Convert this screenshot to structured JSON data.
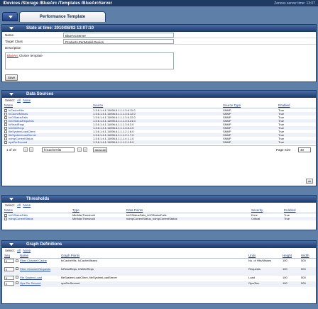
{
  "window": {
    "path_title": "/Devices /Storage /BlueArc /Templates /BlueArcServer",
    "server_time": "Zenoss server time: 13:07"
  },
  "tab": {
    "label": "Performance Template"
  },
  "state_panel": {
    "title": "State at time: 2010/08/02 13:07:10",
    "fields": [
      {
        "label": "Name",
        "value": "BlueArcServer"
      },
      {
        "label": "Target Class",
        "value": "Products.ZenModel.Device"
      },
      {
        "label": "Description",
        "value": ""
      }
    ],
    "description_prefix": "BlueArc",
    "description_rest": " Cluster template",
    "save_label": "Save"
  },
  "select_row": {
    "label": "Select:",
    "all": "All",
    "none": "None"
  },
  "data_sources": {
    "title": "Data Sources",
    "columns": [
      "Name",
      "Source",
      "Source Type",
      "Enabled"
    ],
    "rows": [
      [
        "fcCacheHits",
        "1.3.6.1.4.1.11096.6.1.1.1.3.6.11.0",
        "SNMP",
        "True"
      ],
      [
        "fcCacheMisses",
        "1.3.6.1.4.1.11096.6.1.1.1.3.6.12.0",
        "SNMP",
        "True"
      ],
      [
        "fcIOStatusFails",
        "1.3.6.1.4.1.11096.6.1.1.1.3.6.22.0",
        "SNMP",
        "True"
      ],
      [
        "fcIOStatusRequests",
        "1.3.6.1.4.1.11096.6.1.1.1.3.6.21.0",
        "SNMP",
        "True"
      ],
      [
        "fcReadReqs",
        "1.3.6.1.4.1.11096.6.1.1.1.3.6.3.0",
        "SNMP",
        "True"
      ],
      [
        "fcWriteReqs",
        "1.3.6.1.4.1.11096.6.1.1.1.3.6.4.0",
        "SNMP",
        "True"
      ],
      [
        "fileSystemLoadClient",
        "1.3.6.1.4.1.11096.6.1.1.1.2.1.6.0",
        "SNMP",
        "True"
      ],
      [
        "fileSystemLoadServer",
        "1.3.6.1.4.1.11096.6.1.1.1.2.1.7.0",
        "SNMP",
        "True"
      ],
      [
        "ndmpCurrentStatus",
        "1.3.6.1.4.1.11096.6.1.1.1.4.1.1.0",
        "SNMP",
        "True"
      ],
      [
        "opsPerSecond",
        "1.3.6.1.4.1.11096.6.1.1.1.2.1.5.0",
        "SNMP",
        "True"
      ]
    ],
    "pager": {
      "range": "1 of 10",
      "tool_value": "fcCacheHits",
      "show_all": "show all",
      "page_size_label": "Page Size",
      "page_size_value": "40",
      "ok_label": "ok"
    }
  },
  "thresholds": {
    "title": "Thresholds",
    "columns": [
      "Name",
      "Type",
      "Data Points",
      "Severity",
      "Enabled"
    ],
    "rows": [
      [
        "fcIOStatusFails",
        "MinMaxThreshold",
        "fcIOStatusFails_fcIOStatusFails",
        "Error",
        "True"
      ],
      [
        "ndmpCurrentStatus",
        "MinMaxThreshold",
        "ndmpCurrentStatus_ndmpCurrentStatus",
        "Critical",
        "True"
      ]
    ]
  },
  "graph_definitions": {
    "title": "Graph Definitions",
    "columns": [
      "Seq",
      "Name",
      "Graph Points",
      "Units",
      "Height",
      "Width"
    ],
    "rows": [
      {
        "seq": "0",
        "name": "Fiber Channel Cache",
        "points": "fcCacheHits, fcCacheMisses",
        "units": "No. of Hits/Misses",
        "height": "100",
        "width": "500"
      },
      {
        "seq": "0",
        "name": "Fiber Channel Requests",
        "points": "fcReadReqs, fcWriteReqs",
        "units": "Requests",
        "height": "100",
        "width": "500"
      },
      {
        "seq": "0",
        "name": "File System Load",
        "points": "fileSystemLoadClient, fileSystemLoadServer",
        "units": "Load",
        "height": "100",
        "width": "500"
      },
      {
        "seq": "0",
        "name": "Ops Per Second",
        "points": "opsPerSecond",
        "units": "Ops/Sec",
        "height": "100",
        "width": "500"
      }
    ]
  }
}
